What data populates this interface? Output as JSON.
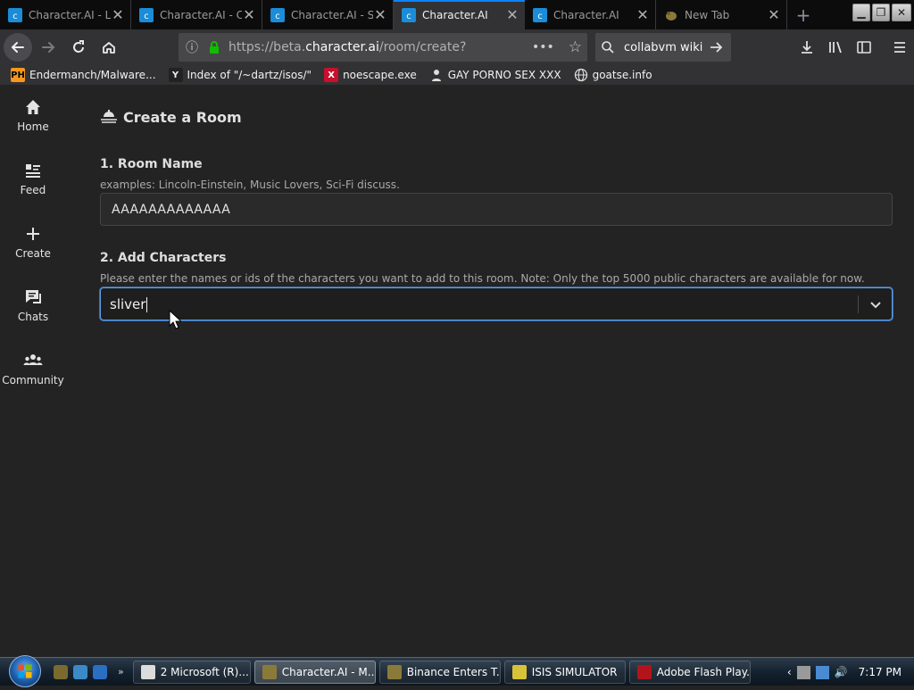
{
  "browser": {
    "tabs": [
      {
        "label": "Character.AI - L",
        "active": false
      },
      {
        "label": "Character.AI - C",
        "active": false
      },
      {
        "label": "Character.AI - S",
        "active": false
      },
      {
        "label": "Character.AI",
        "active": true
      },
      {
        "label": "Character.AI",
        "active": false
      },
      {
        "label": "New Tab",
        "active": false
      }
    ],
    "url_prefix": "https://beta.",
    "url_domain": "character.ai",
    "url_path": "/room/create?",
    "search_value": "collabvm wiki",
    "bookmarks": [
      {
        "label": "Endermanch/Malware...",
        "icon": "ph-icon",
        "icon_text": "PH"
      },
      {
        "label": "Index of \"/~dartz/isos/\"",
        "icon": "yp-icon",
        "icon_text": "Y"
      },
      {
        "label": "noescape.exe",
        "icon": "x-icon",
        "icon_text": "X"
      },
      {
        "label": "GAY PORNO SEX XXX",
        "icon": "person-icon",
        "icon_text": ""
      },
      {
        "label": "goatse.info",
        "icon": "globe-icon",
        "icon_text": ""
      }
    ]
  },
  "sidenav": {
    "items": [
      {
        "label": "Home",
        "icon": "home-icon"
      },
      {
        "label": "Feed",
        "icon": "feed-icon"
      },
      {
        "label": "Create",
        "icon": "plus-icon"
      },
      {
        "label": "Chats",
        "icon": "chat-icon"
      },
      {
        "label": "Community",
        "icon": "community-icon"
      }
    ]
  },
  "page": {
    "title": "Create a Room",
    "room_name": {
      "heading": "1. Room Name",
      "hint": "examples: Lincoln-Einstein, Music Lovers, Sci-Fi discuss.",
      "value": "AAAAAAAAAAAAA"
    },
    "add_characters": {
      "heading": "2. Add Characters",
      "hint": "Please enter the names or ids of the characters you want to add to this room. Note: Only the top 5000 public characters are available for now.",
      "value": "sliver"
    }
  },
  "taskbar": {
    "buttons": [
      {
        "label": "2 Microsoft (R)...",
        "icon": "cmd-icon",
        "active": false
      },
      {
        "label": "Character.AI - M...",
        "icon": "firefox-icon",
        "active": true
      },
      {
        "label": "Binance Enters T...",
        "icon": "firefox-icon",
        "active": false
      },
      {
        "label": "ISIS SIMULATOR",
        "icon": "app-icon",
        "active": false
      },
      {
        "label": "Adobe Flash Play...",
        "icon": "flash-icon",
        "active": false
      }
    ],
    "clock": "7:17 PM"
  },
  "colors": {
    "accent": "#0a84ff",
    "focus_border": "#5d9ce6",
    "page_bg": "#232323"
  }
}
